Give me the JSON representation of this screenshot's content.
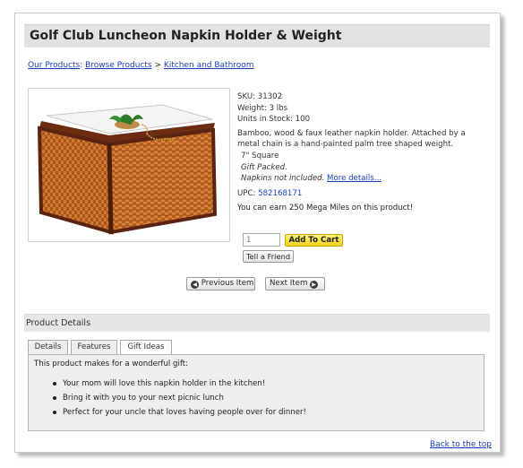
{
  "product": {
    "title": "Golf Club Luncheon Napkin Holder & Weight",
    "sku": "SKU: 31302",
    "weight": "Weight: 3 lbs",
    "stock": "Units in Stock: 100",
    "description": "Bamboo, wood & faux leather napkin holder. Attached by a metal chain is a hand-painted palm tree shaped weight.",
    "size": "7\" Square",
    "gift": "Gift Packed.",
    "napkins_note": "Napkins not included.",
    "more_details": "More details...",
    "upc_label": "UPC:",
    "upc_value": "582168171",
    "miles": "You can earn 250 Mega Miles on this product!",
    "quantity": "1"
  },
  "breadcrumb": {
    "items": [
      "Our Products",
      "Browse Products",
      "Kitchen and Bathroom"
    ],
    "separators": [
      ": ",
      " > "
    ]
  },
  "buttons": {
    "add_to_cart": "Add To Cart",
    "tell_friend": "Tell a Friend",
    "prev": "Previous Item",
    "next": "Next Item"
  },
  "details": {
    "heading": "Product Details",
    "tabs": [
      "Details",
      "Features",
      "Gift Ideas"
    ],
    "active_tab": "Gift Ideas",
    "intro": "This product makes for a wonderful gift:",
    "gift_ideas": [
      "Your mom will love this napkin holder in the kitchen!",
      "Bring it with you to your next picnic lunch",
      "Perfect for your uncle that loves having people over for dinner!"
    ]
  },
  "footer": {
    "back_to_top": "Back to the top"
  },
  "icons": {
    "prev": "circle-left-arrow-icon",
    "next": "circle-right-arrow-icon"
  },
  "colors": {
    "link": "#1a3fc0",
    "title_bar": "#e2e2e2",
    "cart_button": "#f0d21c"
  }
}
